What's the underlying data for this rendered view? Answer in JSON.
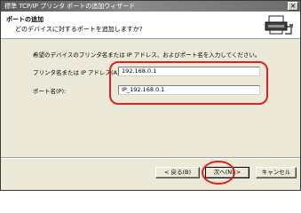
{
  "window": {
    "title": "標準 TCP/IP プリンタ ポートの追加ウィザード",
    "close_label": "×"
  },
  "header": {
    "title": "ポートの追加",
    "subtitle": "どのデバイスに対するポートを追加しますか?",
    "icon": "printer-port-icon"
  },
  "main": {
    "instruction": "希望のデバイスのプリンタ名または IP アドレス、およびポート名を入力してください。",
    "printer_name_label": "プリンタ名または IP アドレス(A):",
    "printer_name_value": "192.168.0.1",
    "port_name_label": "ポート名(P):",
    "port_name_value": "IP_192.168.0.1"
  },
  "buttons": {
    "back": "< 戻る(B)",
    "next": "次へ(N) >",
    "cancel": "キャンセル"
  },
  "colors": {
    "annotation": "#e02020",
    "dialog_bg": "#ece9d8"
  }
}
